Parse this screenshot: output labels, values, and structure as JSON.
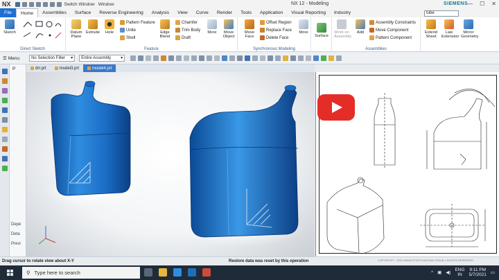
{
  "app": {
    "logo": "NX",
    "window_title": "NX 12 - Modeling",
    "brand": "SIEMENS",
    "switch_window": "Switch Window",
    "window_menu": "Window",
    "controls": [
      "—",
      "☐",
      "✕"
    ]
  },
  "tabs": [
    "File",
    "Home",
    "Assemblies",
    "Surface",
    "Reverse Engineering",
    "Analysis",
    "View",
    "Curve",
    "Render",
    "Tools",
    "Application",
    "Visual Reporting",
    "Industry"
  ],
  "active_tab": "Home",
  "search": {
    "value": "tube"
  },
  "ribbon": {
    "direct_sketch": {
      "label": "Direct Sketch",
      "sketch": "Sketch"
    },
    "feature": {
      "label": "Feature",
      "datum_plane": "Datum Plane",
      "extrude": "Extrude",
      "hole": "Hole",
      "pattern_feature": "Pattern Feature",
      "unite": "Unite",
      "shell": "Shell",
      "edge_blend": "Edge Blend",
      "chamfer": "Chamfer",
      "trim_body": "Trim Body",
      "draft": "Draft",
      "more": "More"
    },
    "sync": {
      "label": "Synchronous Modeling",
      "move_object": "Move Object",
      "move_face": "Move Face",
      "offset_region": "Offset Region",
      "replace_face": "Replace Face",
      "delete_face": "Delete Face",
      "more": "More"
    },
    "surface": {
      "label": "Surface"
    },
    "assemblies": {
      "label": "Assemblies",
      "work_on_assembly": "Work on Assembly",
      "add": "Add",
      "assembly_constraints": "Assembly Constraints",
      "move_component": "Move Component",
      "pattern_component": "Pattern Component"
    },
    "extra": {
      "extend_sheet": "Extend Sheet",
      "law_extension": "Law Extension",
      "mirror_geometry": "Mirror Geometry"
    }
  },
  "toolbar": {
    "menu": "Menu",
    "filter": "No Selection Filter",
    "scope": "Entire Assembly"
  },
  "doc_tabs": [
    "drr.prt",
    "model3.prt",
    "model4.prt"
  ],
  "active_doc": "model4.prt",
  "navpanel": {
    "top": "P",
    "bottom_items": [
      "Depe",
      "Deta",
      "Previ"
    ]
  },
  "status": {
    "left": "Drag cursor to rotate view about X-Y",
    "middle": "Restore data was reset by this operation"
  },
  "drawing": {
    "caption": "COPYRIGHT · 2021 WWW.STUDYCADCAM.COM ALL RIGHTS RESERVED"
  },
  "taskbar": {
    "search_placeholder": "Type here to search",
    "lang_line1": "ENG",
    "lang_line2": "IN",
    "time": "9:11 PM",
    "date": "5/7/2021"
  },
  "colors": {
    "accent": "#1e6fd1",
    "model_blue": "#1f7fd6",
    "youtube_red": "#e52d27",
    "taskbar": "#1f2b38"
  }
}
